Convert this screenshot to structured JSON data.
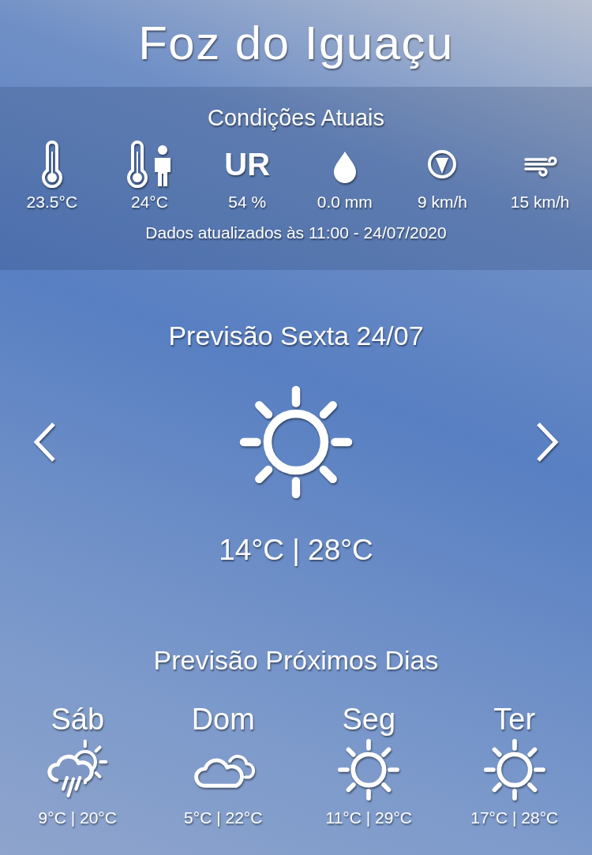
{
  "city": "Foz do Iguaçu",
  "current": {
    "title": "Condições Atuais",
    "items": [
      {
        "kind": "thermometer",
        "value": "23.5°C"
      },
      {
        "kind": "feels-like",
        "value": "24°C"
      },
      {
        "kind": "text",
        "label": "UR",
        "value": "54 %"
      },
      {
        "kind": "drop",
        "value": "0.0 mm"
      },
      {
        "kind": "compass",
        "value": "9 km/h"
      },
      {
        "kind": "wind",
        "value": "15 km/h"
      }
    ],
    "updated": "Dados atualizados às 11:00 - 24/07/2020"
  },
  "today": {
    "title": "Previsão Sexta 24/07",
    "kind": "sun",
    "temps": "14°C | 28°C"
  },
  "next": {
    "title": "Previsão Próximos Dias",
    "days": [
      {
        "day": "Sáb",
        "kind": "rain-sun",
        "temps": "9°C | 20°C"
      },
      {
        "day": "Dom",
        "kind": "cloud",
        "temps": "5°C | 22°C"
      },
      {
        "day": "Seg",
        "kind": "sun",
        "temps": "11°C | 29°C"
      },
      {
        "day": "Ter",
        "kind": "sun",
        "temps": "17°C | 28°C"
      }
    ]
  }
}
